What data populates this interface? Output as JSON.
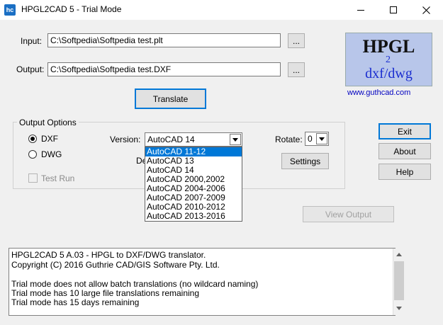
{
  "window": {
    "app_icon": "hc",
    "title": "HPGL2CAD 5 - Trial Mode"
  },
  "input": {
    "label": "Input:",
    "value": "C:\\Softpedia\\Softpedia test.plt",
    "browse_label": "..."
  },
  "output": {
    "label": "Output:",
    "value": "C:\\Softpedia\\Softpedia test.DXF",
    "browse_label": "..."
  },
  "translate_label": "Translate",
  "logo": {
    "hpgl": "HPGL",
    "two": "2",
    "dxf": "dxf/dwg",
    "url": "www.guthcad.com"
  },
  "output_options": {
    "title": "Output Options",
    "dxf_label": "DXF",
    "dwg_label": "DWG",
    "selected_format": "DXF",
    "test_run_label": "Test Run",
    "version_label": "Version:",
    "version_value": "AutoCAD 14",
    "hidden_label_fragment": "De",
    "rotate_label": "Rotate:",
    "rotate_value": "0",
    "settings_label": "Settings",
    "version_options": [
      "AutoCAD 11-12",
      "AutoCAD 13",
      "AutoCAD 14",
      "AutoCAD 2000,2002",
      "AutoCAD 2004-2006",
      "AutoCAD 2007-2009",
      "AutoCAD 2010-2012",
      "AutoCAD 2013-2016"
    ],
    "highlighted_option": "AutoCAD 11-12"
  },
  "buttons": {
    "exit": "Exit",
    "about": "About",
    "help": "Help",
    "view_output": "View Output"
  },
  "log_lines": [
    "HPGL2CAD 5 A.03 - HPGL to DXF/DWG translator.",
    "Copyright (C) 2016 Guthrie CAD/GIS Software Pty. Ltd.",
    "",
    "Trial mode does not allow batch translations (no wildcard naming)",
    "Trial mode has 10 large file translations remaining",
    "Trial mode has 15 days remaining"
  ],
  "colors": {
    "highlight": "#0078d7",
    "url": "#0000c0",
    "logo_bg": "#b8c6ea",
    "logo_text": "#1a2dd0"
  }
}
